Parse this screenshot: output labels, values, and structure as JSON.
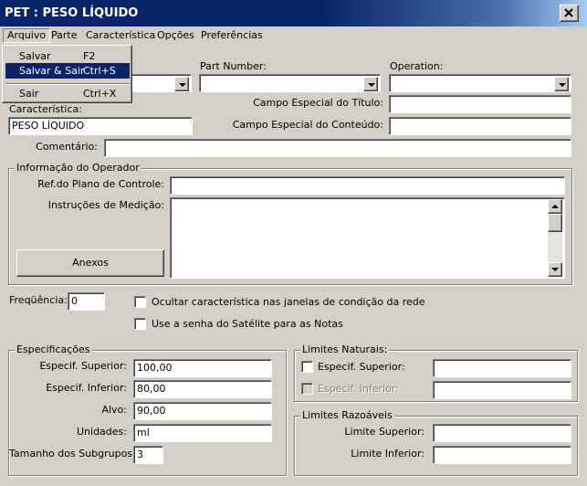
{
  "window": {
    "title": "PET : PESO LÍQUIDO"
  },
  "menu": {
    "arquivo": "Arquivo",
    "parte": "Parte",
    "caracteristica": "Característica",
    "opcoes": "Opções",
    "preferencias": "Preferências"
  },
  "arquivo_menu": {
    "salvar": "Salvar",
    "salvar_sc": "F2",
    "salvar_sair": "Salvar & Sair",
    "salvar_sair_sc": "Ctrl+S",
    "sair": "Sair",
    "sair_sc": "Ctrl+X"
  },
  "header": {
    "part_number_label": "Part Number:",
    "operation_label": "Operation:",
    "part_number": "",
    "operation": "",
    "first_combo": "",
    "campo_titulo_label": "Campo Especial do Título:",
    "campo_titulo": "",
    "caracteristica_label": "Característica:",
    "caracteristica": "PESO LÍQUIDO",
    "campo_conteudo_label": "Campo Especial do Conteúdo:",
    "campo_conteudo": "",
    "comentario_label": "Comentário:",
    "comentario": ""
  },
  "operador": {
    "group_label": "Informação do Operador",
    "ref_label": "Ref.do Plano de Controle:",
    "ref": "",
    "instrucoes_label": "Instruções de Medição:",
    "instrucoes": "",
    "anexos": "Anexos"
  },
  "frequencia": {
    "label": "Freqüência:",
    "value": "0",
    "ocultar": "Ocultar característica nas janelas de condição da rede",
    "senha": "Use a senha do Satélite para as Notas"
  },
  "especificacoes": {
    "group_label": "Especificações",
    "superior_label": "Especif. Superior:",
    "superior": "100,00",
    "inferior_label": "Especif. Inferior:",
    "inferior": "80,00",
    "alvo_label": "Alvo:",
    "alvo": "90,00",
    "unidades_label": "Unidades:",
    "unidades": "ml",
    "subgrupos_label": "Tamanho dos Subgrupos:",
    "subgrupos": "3"
  },
  "limites_naturais": {
    "group_label": "Limites Naturais:",
    "superior_label": "Especif. Superior:",
    "superior": "",
    "inferior_label": "Especif. Inferior:",
    "inferior": ""
  },
  "limites_razoaveis": {
    "group_label": "Limites Razoáveis",
    "superior_label": "Limite Superior:",
    "superior": "",
    "inferior_label": "Limite Inferior:",
    "inferior": ""
  }
}
